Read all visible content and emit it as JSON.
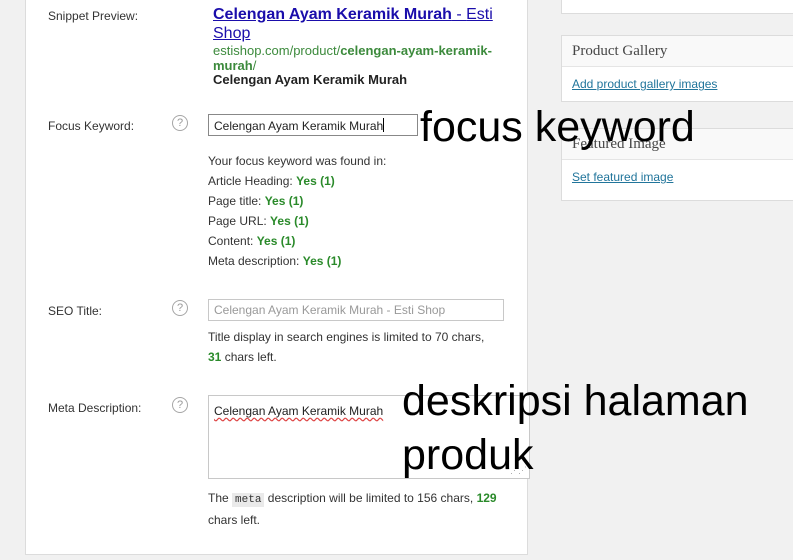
{
  "snippet": {
    "label": "Snippet Preview:",
    "title_bold": "Celengan Ayam Keramik Murah",
    "title_sep": " - ",
    "title_rest": "Esti Shop",
    "url_prefix": "estishop.com/product/",
    "url_slug": "celengan-ayam-keramik-murah",
    "url_suffix": "/",
    "description": "Celengan Ayam Keramik Murah"
  },
  "focus_keyword": {
    "label": "Focus Keyword:",
    "value": "Celengan Ayam Keramik Murah",
    "found_intro": "Your focus keyword was found in:",
    "checks": [
      {
        "label": "Article Heading:",
        "result": "Yes (1)"
      },
      {
        "label": "Page title:",
        "result": "Yes (1)"
      },
      {
        "label": "Page URL:",
        "result": "Yes (1)"
      },
      {
        "label": "Content:",
        "result": "Yes (1)"
      },
      {
        "label": "Meta description:",
        "result": "Yes (1)"
      }
    ]
  },
  "seo_title": {
    "label": "SEO Title:",
    "placeholder": "Celengan Ayam Keramik Murah - Esti Shop",
    "help_line1": "Title display in search engines is limited to 70 chars,",
    "chars_left": "31",
    "help_line2": "chars left."
  },
  "meta_description": {
    "label": "Meta Description:",
    "value": "Celengan Ayam Keramik Murah",
    "help_pre": "The",
    "code": "meta",
    "help_mid": "description will be limited to 156 chars,",
    "chars_left": "129",
    "help_post": "chars left."
  },
  "help_icon_glyph": "?",
  "product_gallery": {
    "title": "Product Gallery",
    "link": "Add product gallery images"
  },
  "featured_image": {
    "title": "Featured Image",
    "link": "Set featured image"
  },
  "annotations": {
    "focus": "focus keyword",
    "desc_line1": "deskripsi halaman",
    "desc_line2": "produk"
  }
}
